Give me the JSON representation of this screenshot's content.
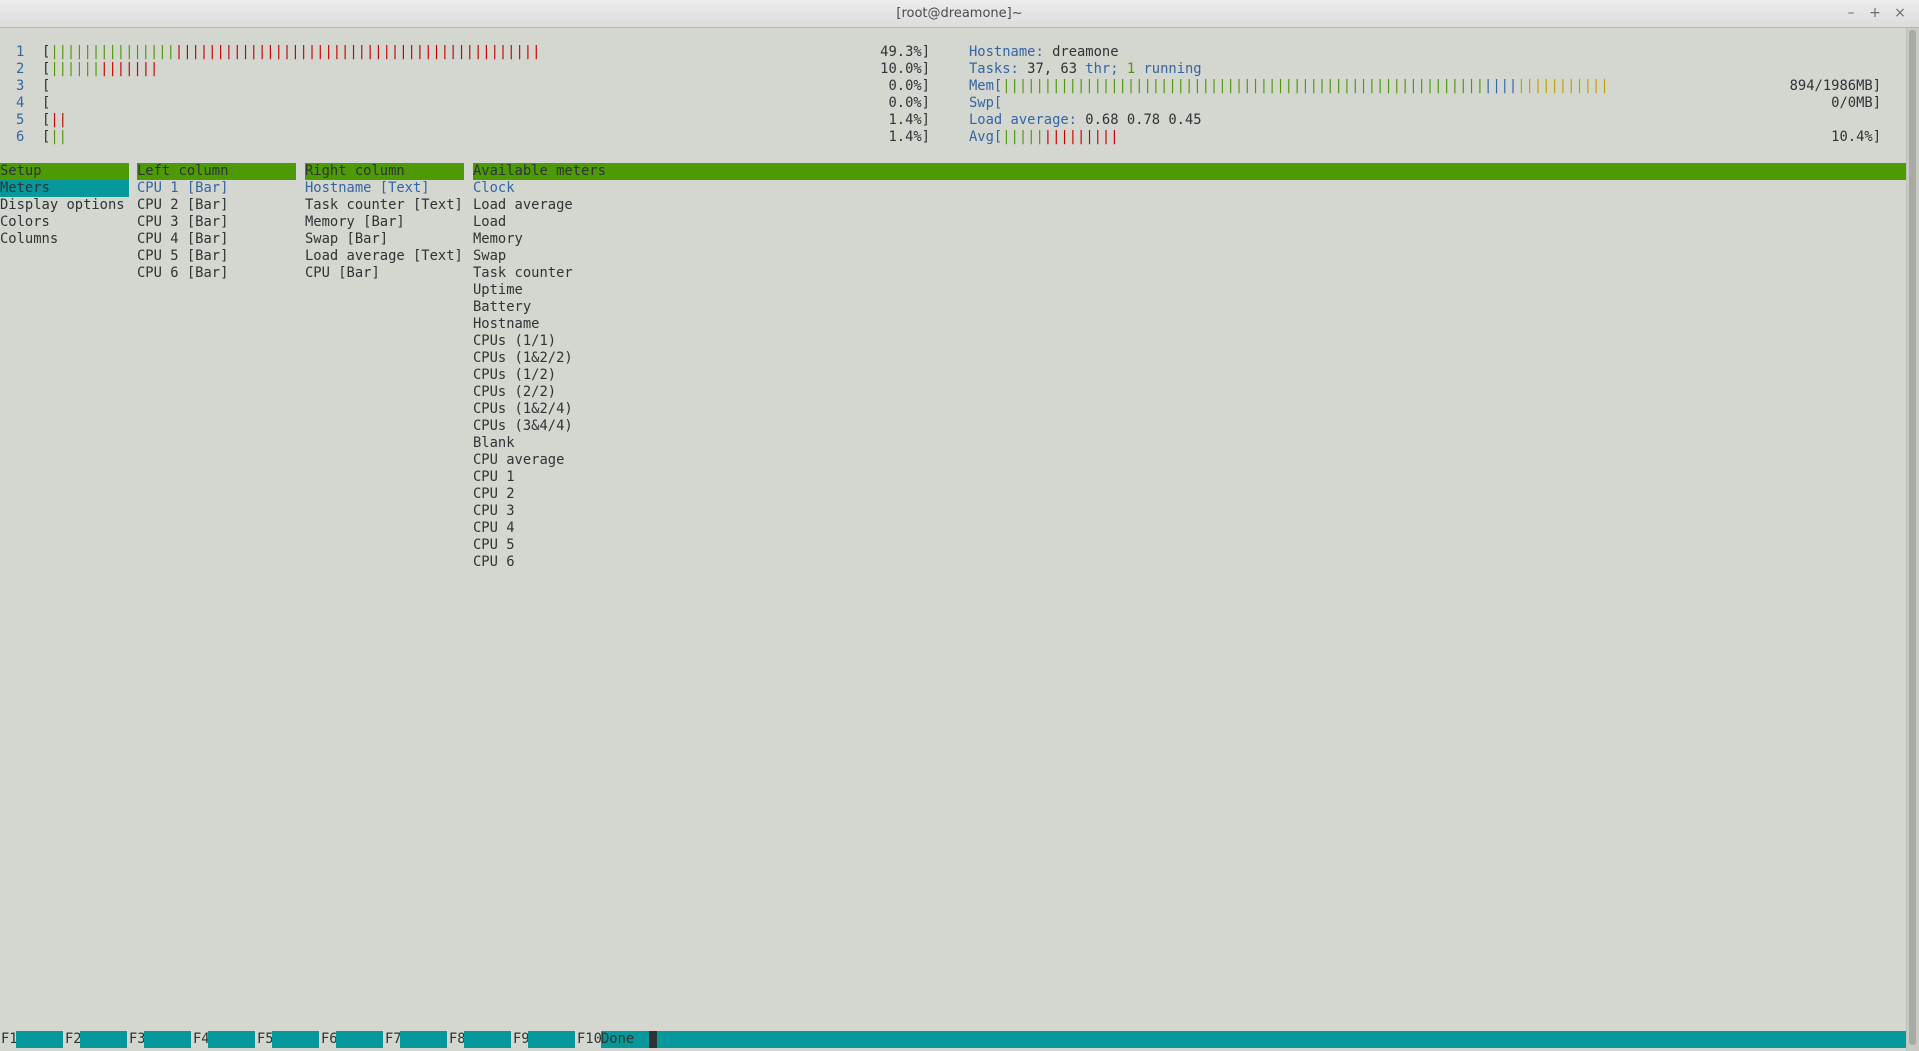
{
  "window": {
    "title": "[root@dreamone]~",
    "controls": [
      "–",
      "+",
      "×"
    ]
  },
  "cpus": [
    {
      "num": "1",
      "green_bars": "|||||||||||||||",
      "red_bars": "||||||||||||||||||||||||||||||||||||||||||||",
      "percent": "49.3%]"
    },
    {
      "num": "2",
      "green_bars": "||||||",
      "red_bars": "|||||||",
      "percent": "10.0%]"
    },
    {
      "num": "3",
      "green_bars": "",
      "red_bars": "",
      "percent": "0.0%]"
    },
    {
      "num": "4",
      "green_bars": "",
      "red_bars": "",
      "percent": "0.0%]"
    },
    {
      "num": "5",
      "green_bars": "",
      "red_bars": "||",
      "percent": "1.4%]"
    },
    {
      "num": "6",
      "green_bars": "||",
      "red_bars": "",
      "percent": "1.4%]"
    }
  ],
  "right_meters": {
    "hostname_label": "Hostname: ",
    "hostname_value": "dreamone",
    "tasks_label": "Tasks: ",
    "tasks_value": "37, 63",
    "tasks_thr": " thr; ",
    "tasks_running_count": "1",
    "tasks_running_label": " running",
    "mem_label": "Mem[",
    "mem_green": "||||||||||||||||||||||||||||||||||||||||||||||||||||||||||",
    "mem_blue": "||||",
    "mem_orange": "|||||||||||",
    "mem_value": "894/1986MB]",
    "swp_label": "Swp[",
    "swp_value": "0/0MB]",
    "load_label": "Load average: ",
    "load_value": "0.68 0.78 0.45",
    "avg_label": "Avg[",
    "avg_green": "|||||",
    "avg_red": "|||||||||",
    "avg_value": "10.4%]"
  },
  "setup": {
    "header": "Setup",
    "items": [
      "Meters",
      "Display options",
      "Colors",
      "Columns"
    ],
    "selected": "Meters"
  },
  "left_column": {
    "header": "Left column",
    "items": [
      "CPU 1 [Bar]",
      "CPU 2 [Bar]",
      "CPU 3 [Bar]",
      "CPU 4 [Bar]",
      "CPU 5 [Bar]",
      "CPU 6 [Bar]"
    ]
  },
  "right_column": {
    "header": "Right column",
    "items": [
      "Hostname [Text]",
      "Task counter [Text]",
      "Memory [Bar]",
      "Swap [Bar]",
      "Load average [Text]",
      "CPU [Bar]"
    ]
  },
  "available_meters": {
    "header": "Available meters",
    "items": [
      "Clock",
      "Load average",
      "Load",
      "Memory",
      "Swap",
      "Task counter",
      "Uptime",
      "Battery",
      "Hostname",
      "CPUs (1/1)",
      "CPUs (1&2/2)",
      "CPUs (1/2)",
      "CPUs (2/2)",
      "CPUs (1&2/4)",
      "CPUs (3&4/4)",
      "Blank",
      "CPU average",
      "CPU 1",
      "CPU 2",
      "CPU 3",
      "CPU 4",
      "CPU 5",
      "CPU 6"
    ]
  },
  "footer": {
    "keys": [
      "F1",
      "F2",
      "F3",
      "F4",
      "F5",
      "F6",
      "F7",
      "F8",
      "F9",
      "F10"
    ],
    "done_label": "Done"
  },
  "colors": {
    "background": "#d3d7cf",
    "header_green": "#4e9a06",
    "selection_cyan": "#06989a",
    "text_blue": "#3465a4",
    "bar_red": "#cc0000"
  }
}
